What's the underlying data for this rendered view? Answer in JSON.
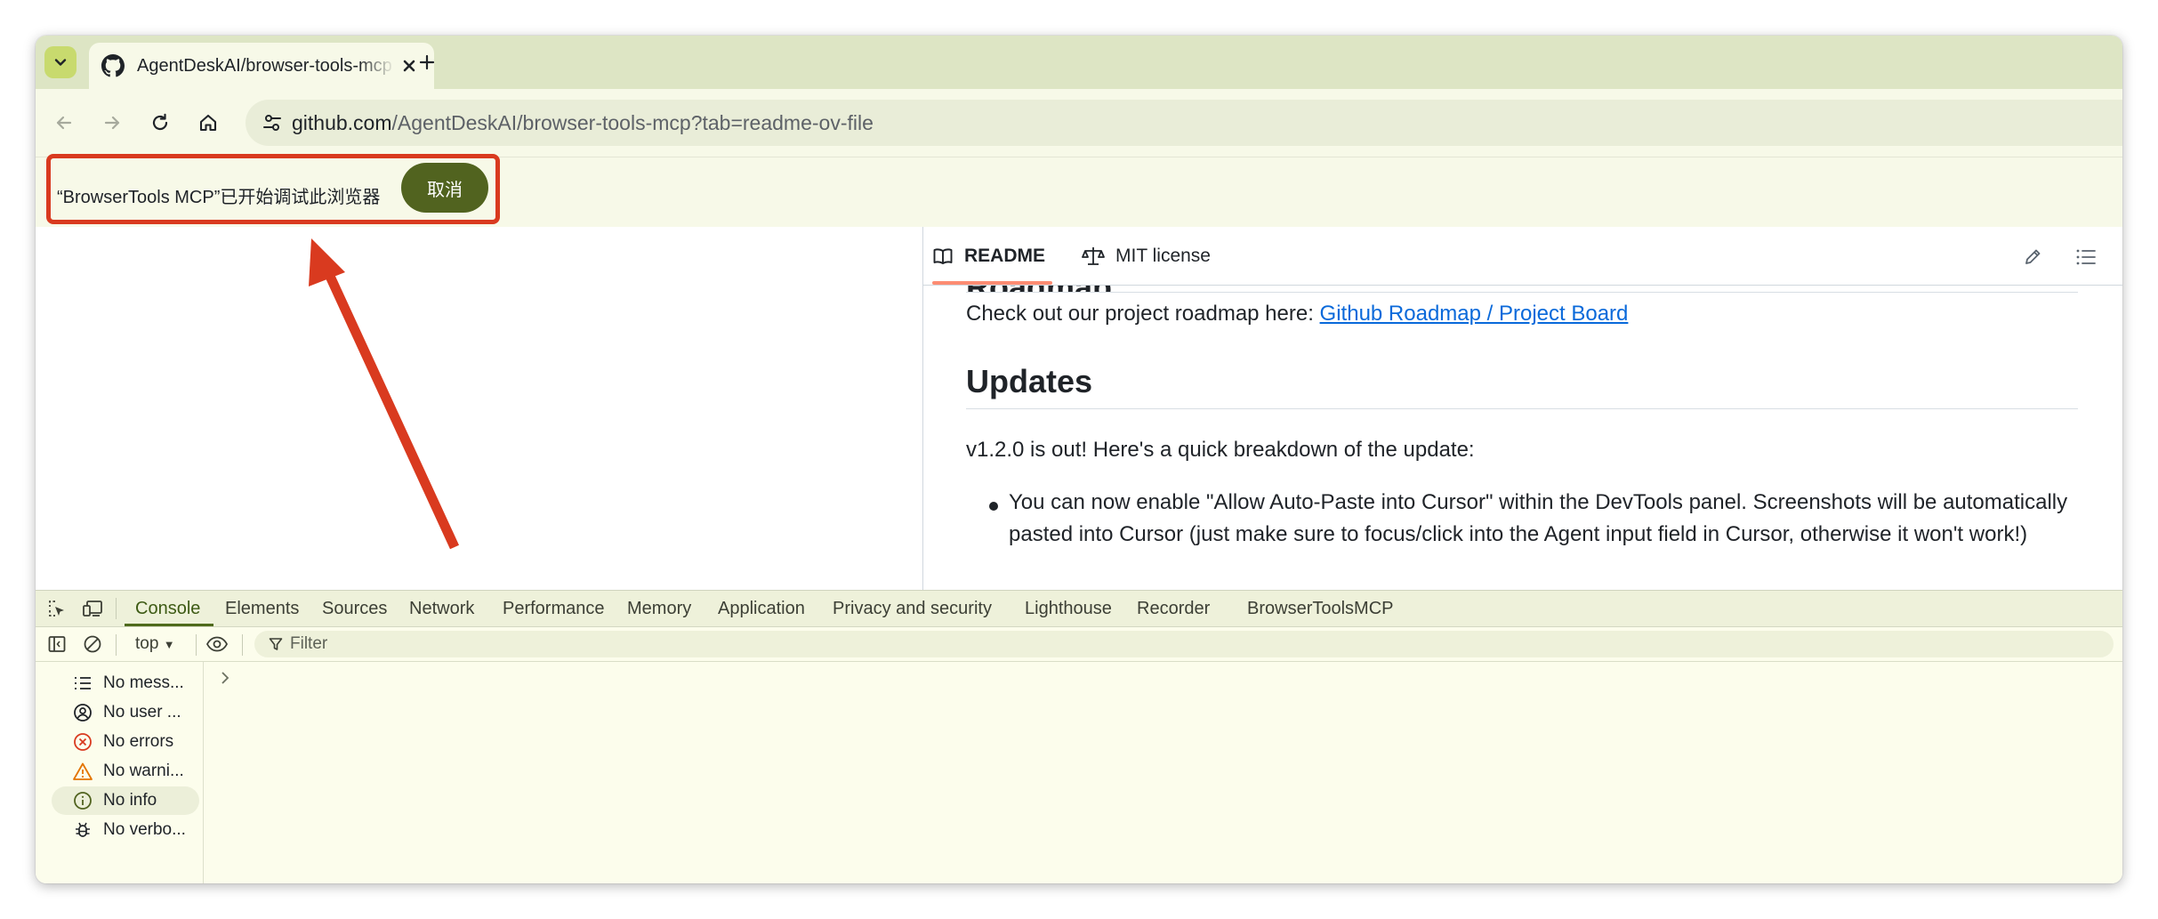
{
  "browser": {
    "tab": {
      "title": "AgentDeskAI/browser-tools-mcp",
      "favicon": "github-icon",
      "close_icon": "close-icon"
    },
    "newtab_icon": "plus-icon",
    "address": {
      "host": "github.com",
      "path": "/AgentDeskAI/browser-tools-mcp?tab=readme-ov-file"
    },
    "infobar": {
      "message": "“BrowserTools MCP”已开始调试此浏览器",
      "cancel_label": "取消"
    }
  },
  "readme": {
    "tabs": [
      {
        "label": "README",
        "icon": "book-icon"
      },
      {
        "label": "MIT license",
        "icon": "scale-icon"
      }
    ],
    "roadmap_heading": "Roadmap",
    "roadmap_text": "Check out our project roadmap here: ",
    "roadmap_link": "Github Roadmap / Project Board",
    "updates_heading": "Updates",
    "updates_intro": "v1.2.0 is out! Here's a quick breakdown of the update:",
    "bullet_line1": "You can now enable \"Allow Auto-Paste into Cursor\" within the DevTools panel. Screenshots will be automatically",
    "bullet_line2": "pasted into Cursor (just make sure to focus/click into the Agent input field in Cursor, otherwise it won't work!)"
  },
  "devtools": {
    "tabs": [
      "Console",
      "Elements",
      "Sources",
      "Network",
      "Performance",
      "Memory",
      "Application",
      "Privacy and security",
      "Lighthouse",
      "Recorder",
      "BrowserToolsMCP"
    ],
    "active_tab": "Console",
    "context": "top",
    "filter_placeholder": "Filter",
    "sidebar": [
      {
        "label": "No mess...",
        "icon": "list-icon"
      },
      {
        "label": "No user ...",
        "icon": "user-icon"
      },
      {
        "label": "No errors",
        "icon": "error-icon"
      },
      {
        "label": "No warni...",
        "icon": "warning-icon"
      },
      {
        "label": "No info",
        "icon": "info-icon"
      },
      {
        "label": "No verbo...",
        "icon": "bug-icon"
      }
    ]
  },
  "colors": {
    "accent": "#51631f",
    "annotation": "#d93a1f",
    "link": "#0969da"
  }
}
